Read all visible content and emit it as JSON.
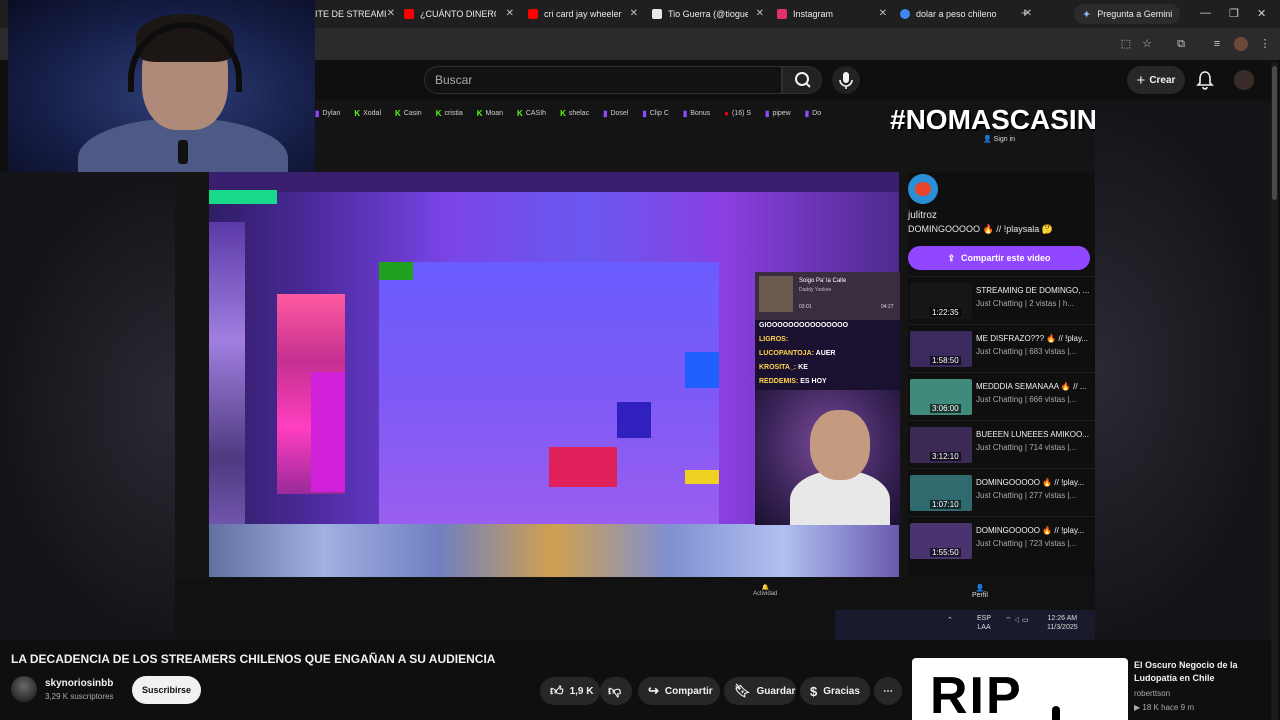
{
  "browser": {
    "tabs": [
      {
        "label": "ITE DE STREAMI",
        "icon": "tab-favicon",
        "color": "#c5221f"
      },
      {
        "label": "¿CUÁNTO DINERO G/",
        "icon": "youtube-icon",
        "color": "#ff0000"
      },
      {
        "label": "cri card jay wheeler c",
        "icon": "youtube-icon",
        "color": "#ff0000"
      },
      {
        "label": "Tio Guerra (@tioguer",
        "icon": "tiktok-icon",
        "color": "#ffffff"
      },
      {
        "label": "Instagram",
        "icon": "instagram-icon",
        "color": "#e1306c"
      },
      {
        "label": "dolar a peso chileno",
        "icon": "google-icon",
        "color": "#4285f4"
      }
    ],
    "new_tab": "+",
    "gemini_label": "Pregunta a Gemini"
  },
  "youtube": {
    "search_placeholder": "Buscar",
    "create_label": "Crear"
  },
  "video": {
    "bookmarks": [
      "Dylan",
      "Xodal",
      "Casin",
      "cristia",
      "Moan",
      "CASIh",
      "shelac",
      "Dosel",
      "Clip C",
      "Bonus",
      "(16) S",
      "pipew",
      "Do"
    ],
    "hashtag": "#NOMASCASINOS",
    "sign_in": "Sign in",
    "channel_name": "julitroz",
    "channel_desc": "DOMINGOOOOO 🔥 // !playsala 🤔",
    "share_button": "Compartir este video",
    "now_playing_title": "Soigo Pa' la Calle",
    "now_playing_artist": "Daddy Yankee",
    "now_playing_time_start": "03:01",
    "now_playing_time_end": "04:27",
    "chat": [
      {
        "user": "",
        "text": "GIOOOOOOOOOOOOOOO"
      },
      {
        "user": "LIGROS:",
        "text": ""
      },
      {
        "user": "LUCOPANTOJA:",
        "text": "AUER"
      },
      {
        "user": "KROSITA_:",
        "text": "KE"
      },
      {
        "user": "REDDEMIS:",
        "text": "ES HOY"
      }
    ],
    "videos": [
      {
        "title": "STREAMING DE DOMINGO, ...",
        "meta": "Just Chatting | 2 vistas | h...",
        "duration": "1:22:35",
        "thumb": "#1f1f1f"
      },
      {
        "title": "ME DISFRAZO??? 🔥 // !play...",
        "meta": "Just Chatting | 683 vistas |...",
        "duration": "1:58:50",
        "thumb": "#3b2a5e"
      },
      {
        "title": "MEDDDIA SEMANAAA 🔥 // ...",
        "meta": "Just Chatting | 666 vistas |...",
        "duration": "3:06:00",
        "thumb": "#3f8a7a"
      },
      {
        "title": "BUEEEN LUNEEES AMIKOO...",
        "meta": "Just Chatting | 714 vistas |...",
        "duration": "3:12:10",
        "thumb": "#3a2a55"
      },
      {
        "title": "DOMINGOOOOO 🔥 // !play...",
        "meta": "Just Chatting | 277 vistas |...",
        "duration": "1:07:10",
        "thumb": "#2e6a6e"
      },
      {
        "title": "DOMINGOOOOO 🔥 // !play...",
        "meta": "Just Chatting | 723 vistas |...",
        "duration": "1:55:50",
        "thumb": "#4a3470"
      }
    ],
    "perfil": "Perfil",
    "actividad": "Actividad",
    "taskbar": {
      "lang": "ESP",
      "region": "LAA",
      "time": "12:26 AM",
      "date": "11/3/2025"
    }
  },
  "info": {
    "title": "LA DECADENCIA DE LOS STREAMERS CHILENOS QUE ENGAÑAN A SU AUDIENCIA",
    "channel": "skynoriosinbb",
    "subscribers": "3,29 K suscriptores",
    "subscribe": "Suscribirse",
    "likes": "1,9 K",
    "share": "Compartir",
    "save": "Guardar",
    "thanks": "Gracias",
    "more": "⋯"
  },
  "recommended": {
    "thumb_text": "RIP",
    "title": "El Oscuro Negocio de la Ludopatía en Chile",
    "channel": "roberttson",
    "views": "18 K",
    "age": "hace 9 m"
  }
}
